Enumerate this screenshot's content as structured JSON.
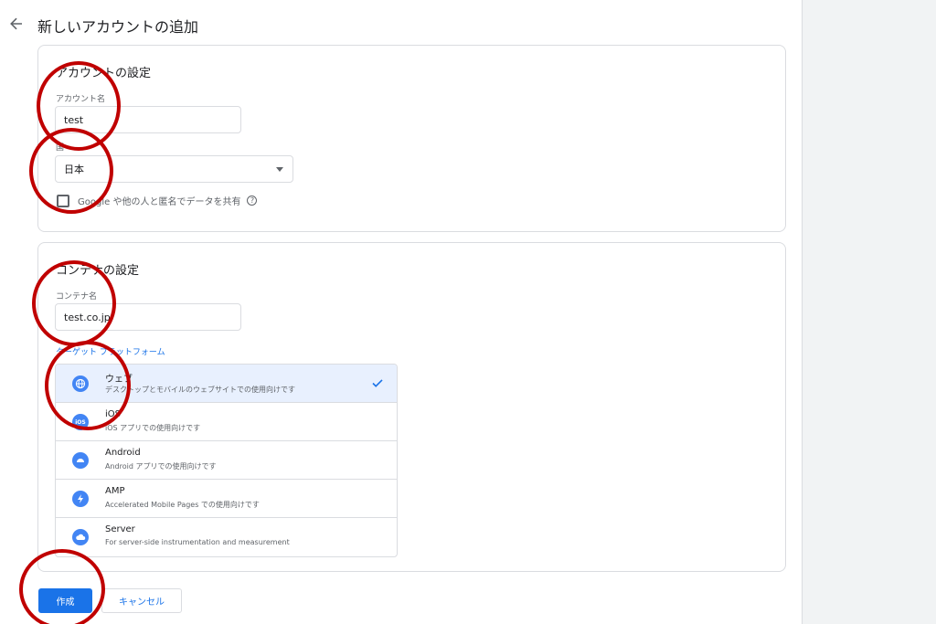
{
  "header": {
    "title": "新しいアカウントの追加",
    "back_icon": "arrow-back-icon"
  },
  "account_section": {
    "title": "アカウントの設定",
    "name_label": "アカウント名",
    "name_value": "test",
    "country_label": "国",
    "country_value": "日本",
    "share_label": "Google や他の人と匿名でデータを共有",
    "share_checked": false,
    "help_glyph": "?"
  },
  "container_section": {
    "title": "コンテナの設定",
    "name_label": "コンテナ名",
    "name_value": "test.co.jp",
    "platform_label": "ターゲット プラットフォーム",
    "platforms": [
      {
        "name": "ウェブ",
        "desc": "デスクトップとモバイルのウェブサイトでの使用向けです",
        "icon": "globe-icon",
        "selected": true
      },
      {
        "name": "iOS",
        "desc": "iOS アプリでの使用向けです",
        "icon": "ios-icon",
        "selected": false
      },
      {
        "name": "Android",
        "desc": "Android アプリでの使用向けです",
        "icon": "android-icon",
        "selected": false
      },
      {
        "name": "AMP",
        "desc": "Accelerated Mobile Pages での使用向けです",
        "icon": "lightning-icon",
        "selected": false
      },
      {
        "name": "Server",
        "desc": "For server-side instrumentation and measurement",
        "icon": "cloud-icon",
        "selected": false
      }
    ]
  },
  "actions": {
    "create_label": "作成",
    "cancel_label": "キャンセル"
  },
  "colors": {
    "accent": "#1a73e8",
    "icon_blue": "#4285f4",
    "selected_bg": "#e8f0fe",
    "annotation_red": "#c00000"
  }
}
